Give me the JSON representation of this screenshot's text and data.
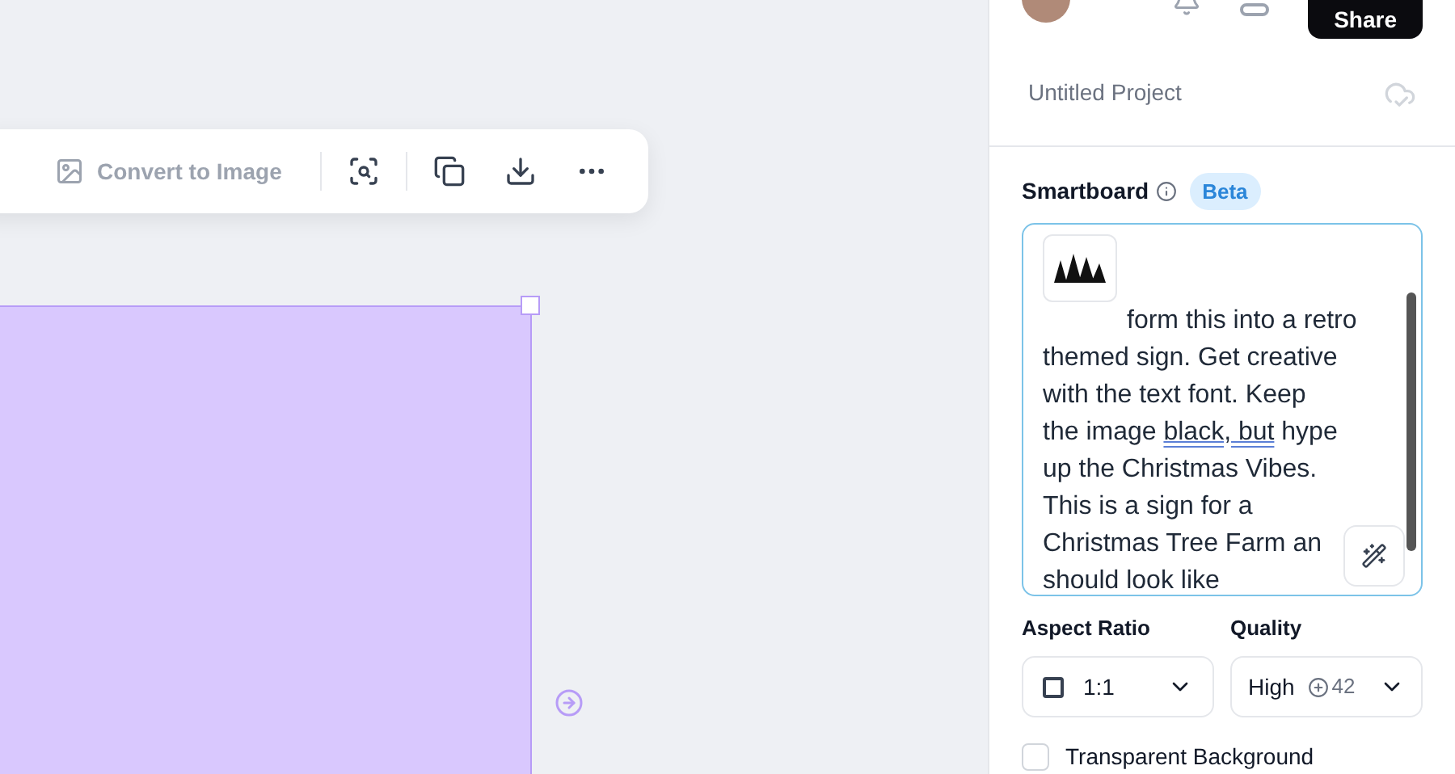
{
  "toolbar": {
    "convert_label": "Convert to Image"
  },
  "header": {
    "share_label": "Share"
  },
  "project": {
    "title": "Untitled Project"
  },
  "smartboard": {
    "title": "Smartboard",
    "badge": "Beta",
    "prompt_lines": [
      [
        {
          "text": "form this into a retro",
          "underlined": false
        }
      ],
      [
        {
          "text": "themed sign. Get creative",
          "underlined": false
        }
      ],
      [
        {
          "text": "with the text font. Keep",
          "underlined": false
        }
      ],
      [
        {
          "text": "the image ",
          "underlined": false
        },
        {
          "text": "black, but",
          "underlined": true
        },
        {
          "text": " hype",
          "underlined": false
        }
      ],
      [
        {
          "text": "up the Christmas Vibes.",
          "underlined": false
        }
      ],
      [
        {
          "text": "This is a sign for a",
          "underlined": false
        }
      ],
      [
        {
          "text": "Christmas Tree Farm an",
          "underlined": false
        }
      ],
      [
        {
          "text": "should look like",
          "underlined": false
        }
      ]
    ]
  },
  "aspect_ratio": {
    "label": "Aspect Ratio",
    "value": "1:1"
  },
  "quality": {
    "label": "Quality",
    "value": "High",
    "credits": "42"
  },
  "transparent_background": {
    "label": "Transparent Background",
    "checked": false
  }
}
